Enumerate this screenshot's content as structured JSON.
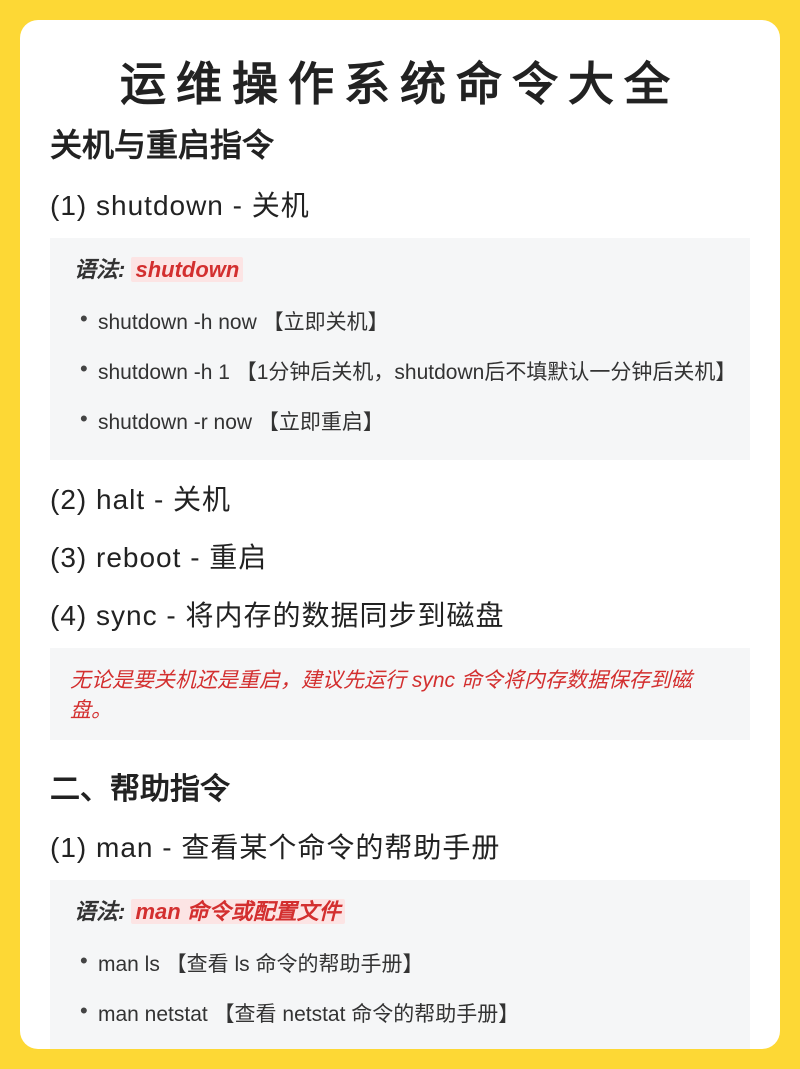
{
  "title": "运维操作系统命令大全",
  "section1": {
    "heading": "关机与重启指令",
    "items": [
      {
        "num": "(1)",
        "label": "shutdown - 关机",
        "syntax_label": "语法:",
        "syntax_value": "shutdown",
        "examples": [
          "shutdown -h now 【立即关机】",
          "shutdown -h 1 【1分钟后关机，shutdown后不填默认一分钟后关机】",
          "shutdown -r now 【立即重启】"
        ]
      },
      {
        "num": "(2)",
        "label": "halt - 关机"
      },
      {
        "num": "(3)",
        "label": "reboot - 重启"
      },
      {
        "num": "(4)",
        "label": "sync - 将内存的数据同步到磁盘"
      }
    ],
    "tip": "无论是要关机还是重启，建议先运行 sync 命令将内存数据保存到磁盘。"
  },
  "section2": {
    "heading": "二、帮助指令",
    "items": [
      {
        "num": "(1)",
        "label": "man - 查看某个命令的帮助手册",
        "syntax_label": "语法:",
        "syntax_value": "man 命令或配置文件",
        "examples": [
          "man ls 【查看 ls 命令的帮助手册】",
          "man netstat 【查看 netstat 命令的帮助手册】"
        ]
      }
    ]
  }
}
